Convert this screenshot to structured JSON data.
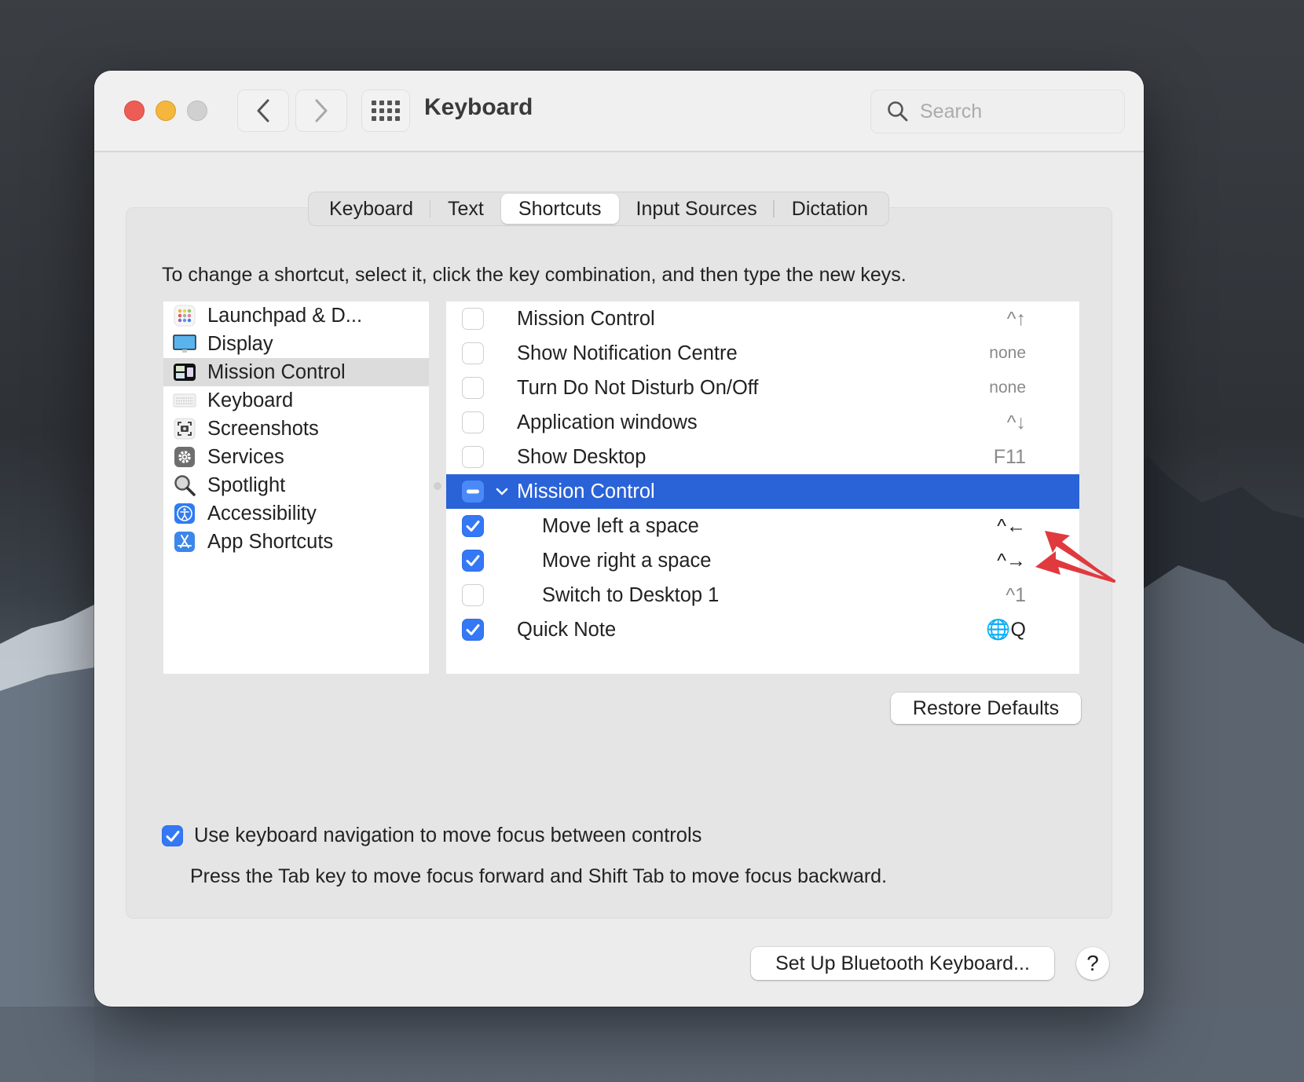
{
  "window": {
    "title": "Keyboard",
    "search_placeholder": "Search",
    "search_value": ""
  },
  "toolbar": {
    "back_icon": "chevron-left-icon",
    "forward_icon": "chevron-right-icon",
    "grid_icon": "show-all-grid-icon"
  },
  "tabs": [
    {
      "label": "Keyboard",
      "active": false
    },
    {
      "label": "Text",
      "active": false
    },
    {
      "label": "Shortcuts",
      "active": true
    },
    {
      "label": "Input Sources",
      "active": false
    },
    {
      "label": "Dictation",
      "active": false
    }
  ],
  "instructions": "To change a shortcut, select it, click the key combination, and then type the new keys.",
  "categories": [
    {
      "label": "Launchpad & D...",
      "icon": "launchpad-icon",
      "selected": false
    },
    {
      "label": "Display",
      "icon": "display-icon",
      "selected": false
    },
    {
      "label": "Mission Control",
      "icon": "mission-control-icon",
      "selected": true
    },
    {
      "label": "Keyboard",
      "icon": "keyboard-icon",
      "selected": false
    },
    {
      "label": "Screenshots",
      "icon": "screenshot-icon",
      "selected": false
    },
    {
      "label": "Services",
      "icon": "gear-icon",
      "selected": false
    },
    {
      "label": "Spotlight",
      "icon": "magnifier-icon",
      "selected": false
    },
    {
      "label": "Accessibility",
      "icon": "accessibility-icon",
      "selected": false
    },
    {
      "label": "App Shortcuts",
      "icon": "app-store-icon",
      "selected": false
    }
  ],
  "shortcuts": [
    {
      "label": "Mission Control",
      "key": "^↑",
      "state": "unchecked",
      "level": 0
    },
    {
      "label": "Show Notification Centre",
      "key": "none",
      "state": "unchecked",
      "level": 0
    },
    {
      "label": "Turn Do Not Disturb On/Off",
      "key": "none",
      "state": "unchecked",
      "level": 0
    },
    {
      "label": "Application windows",
      "key": "^↓",
      "state": "unchecked",
      "level": 0
    },
    {
      "label": "Show Desktop",
      "key": "F11",
      "state": "unchecked",
      "level": 0
    },
    {
      "label": "Mission Control",
      "key": "",
      "state": "mixed",
      "level": 0,
      "group": true,
      "selected": true
    },
    {
      "label": "Move left a space",
      "key": "^←",
      "state": "checked",
      "level": 1
    },
    {
      "label": "Move right a space",
      "key": "^→",
      "state": "checked",
      "level": 1
    },
    {
      "label": "Switch to Desktop 1",
      "key": "^1",
      "state": "unchecked",
      "level": 1
    },
    {
      "label": "Quick Note",
      "key": "🌐Q",
      "state": "checked",
      "level": 0
    }
  ],
  "buttons": {
    "restore_defaults": "Restore Defaults",
    "bluetooth": "Set Up Bluetooth Keyboard...",
    "help": "?"
  },
  "keyboard_navigation": {
    "label": "Use keyboard navigation to move focus between controls",
    "checked": true,
    "hint": "Press the Tab key to move focus forward and Shift Tab to move focus backward."
  },
  "colors": {
    "accent": "#2a62d8",
    "checkbox": "#3478f6",
    "annotation_arrow": "#e0393e"
  }
}
